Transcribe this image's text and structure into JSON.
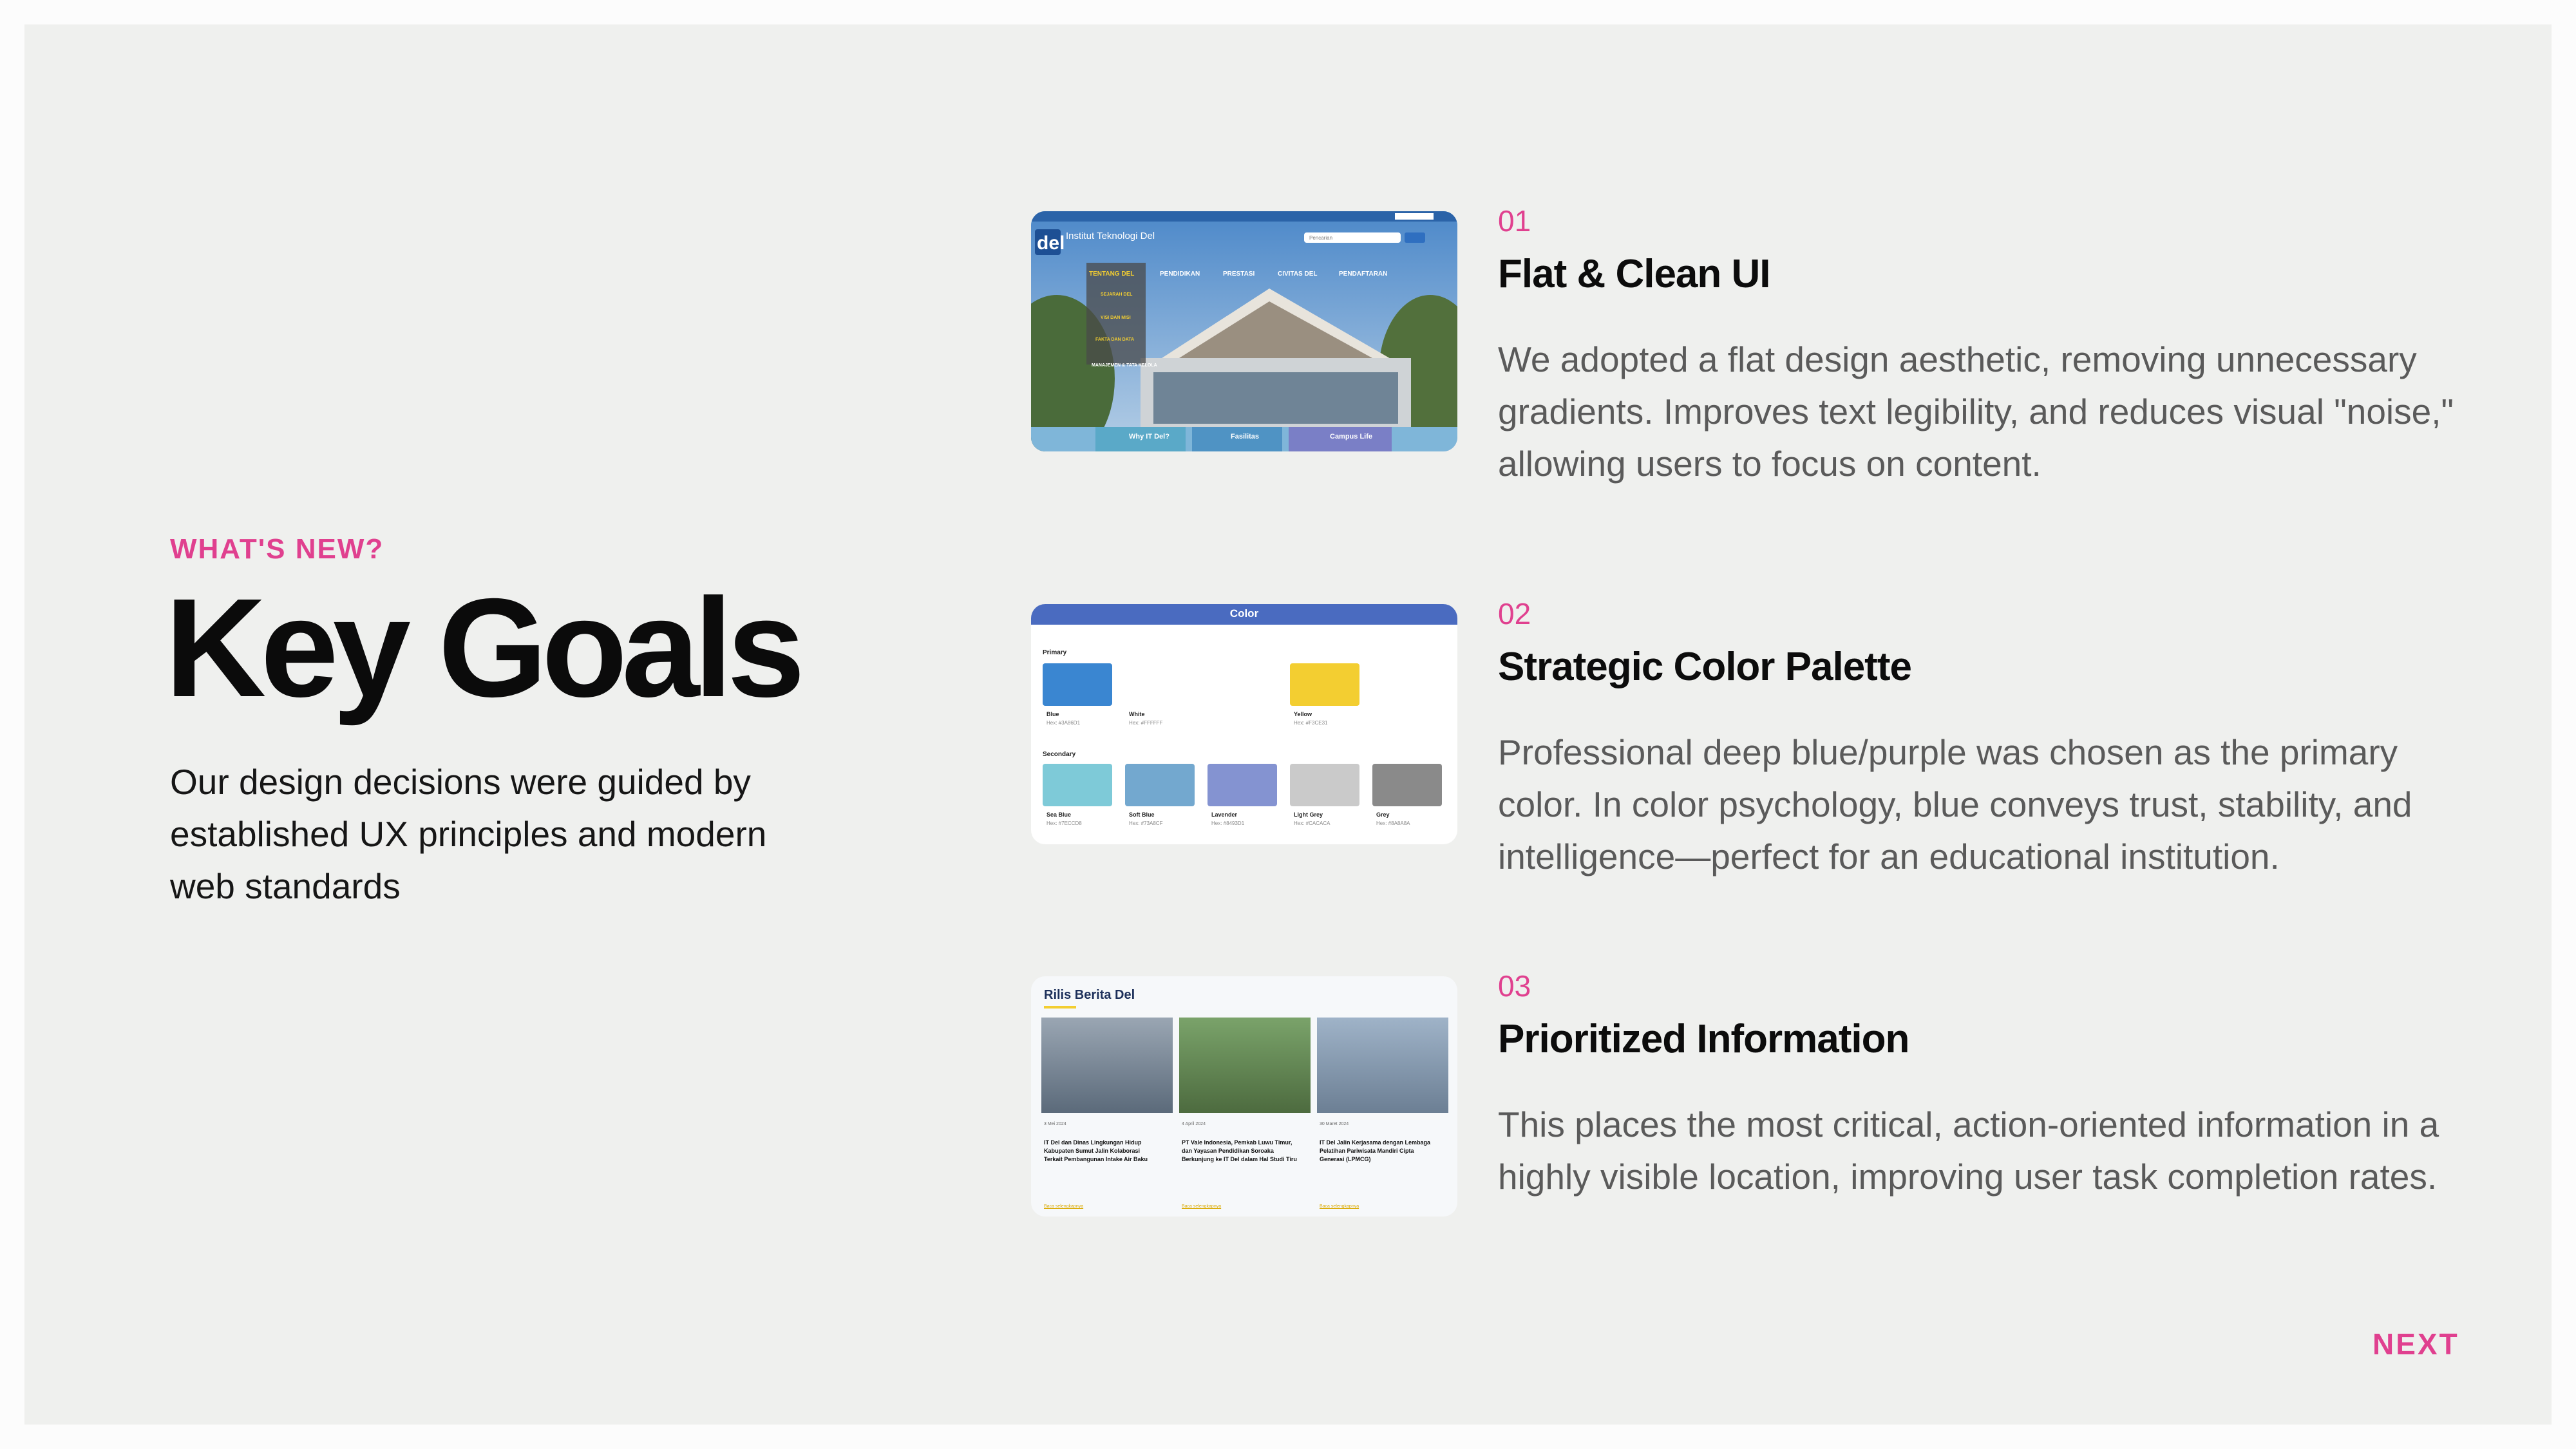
{
  "eyebrow": "WHAT'S NEW?",
  "title": "Key Goals",
  "lead": "Our design decisions were guided by established UX principles and modern web standards",
  "items": [
    {
      "num": "01",
      "title": "Flat & Clean UI",
      "body": "We adopted a flat design aesthetic, removing unnecessary gradients. Improves text legibility, and reduces visual \"noise,\" allowing users to focus on content.",
      "thumb": {
        "brand": "del",
        "site_title": "Institut Teknologi Del",
        "search_placeholder": "Pencarian",
        "nav": [
          "TENTANG DEL",
          "PENDIDIKAN",
          "PRESTASI",
          "CIVITAS DEL",
          "PENDAFTARAN"
        ],
        "menu": [
          "SEJARAH DEL",
          "VISI DAN MISI",
          "FAKTA DAN DATA",
          "MANAJEMEN & TATA KELOLA"
        ],
        "cards": [
          "Why IT Del?",
          "Fasilitas",
          "Campus Life"
        ]
      }
    },
    {
      "num": "02",
      "title": "Strategic Color Palette",
      "body": "Professional deep blue/purple was chosen as the primary color. In color psychology, blue conveys trust, stability, and intelligence—perfect for an educational institution.",
      "thumb": {
        "header": "Color",
        "primary_label": "Primary",
        "secondary_label": "Secondary",
        "primary": [
          {
            "name": "Blue",
            "hex": "Hex: #3A86D1",
            "color": "#3a86d1"
          },
          {
            "name": "White",
            "hex": "Hex: #FFFFFF",
            "color": "#ffffff"
          },
          {
            "name": "Yellow",
            "hex": "Hex: #F3CE31",
            "color": "#f3ce31"
          }
        ],
        "secondary": [
          {
            "name": "Sea Blue",
            "hex": "Hex: #7ECCD8",
            "color": "#7ecad8"
          },
          {
            "name": "Soft Blue",
            "hex": "Hex: #73A8CF",
            "color": "#73a8cf"
          },
          {
            "name": "Lavender",
            "hex": "Hex: #8493D1",
            "color": "#8493d1"
          },
          {
            "name": "Light Grey",
            "hex": "Hex: #CACACA",
            "color": "#cacaca"
          },
          {
            "name": "Grey",
            "hex": "Hex: #8A8A8A",
            "color": "#8a8a8a"
          }
        ]
      }
    },
    {
      "num": "03",
      "title": "Prioritized Information",
      "body": "This places the most critical, action-oriented information in a highly visible location, improving user task completion rates.",
      "thumb": {
        "header": "Rilis Berita Del",
        "news": [
          {
            "date": "3 Mei 2024",
            "headline": "IT Del dan Dinas Lingkungan Hidup Kabupaten Sumut Jalin Kolaborasi Terkait Pembangunan Intake Air Baku",
            "link": "Baca selengkapnya"
          },
          {
            "date": "4 April 2024",
            "headline": "PT Vale Indonesia, Pemkab Luwu Timur, dan Yayasan Pendidikan Soroaka Berkunjung ke IT Del dalam Hal Studi Tiru",
            "link": "Baca selengkapnya"
          },
          {
            "date": "30 Maret 2024",
            "headline": "IT Del Jalin Kerjasama dengan Lembaga Pelatihan Pariwisata Mandiri Cipta Generasi (LPMCG)",
            "link": "Baca selengkapnya"
          }
        ]
      }
    }
  ],
  "next_label": "NEXT",
  "colors": {
    "accent": "#e0408f",
    "background": "#eff0ee",
    "body_text": "#5a5a5a"
  }
}
